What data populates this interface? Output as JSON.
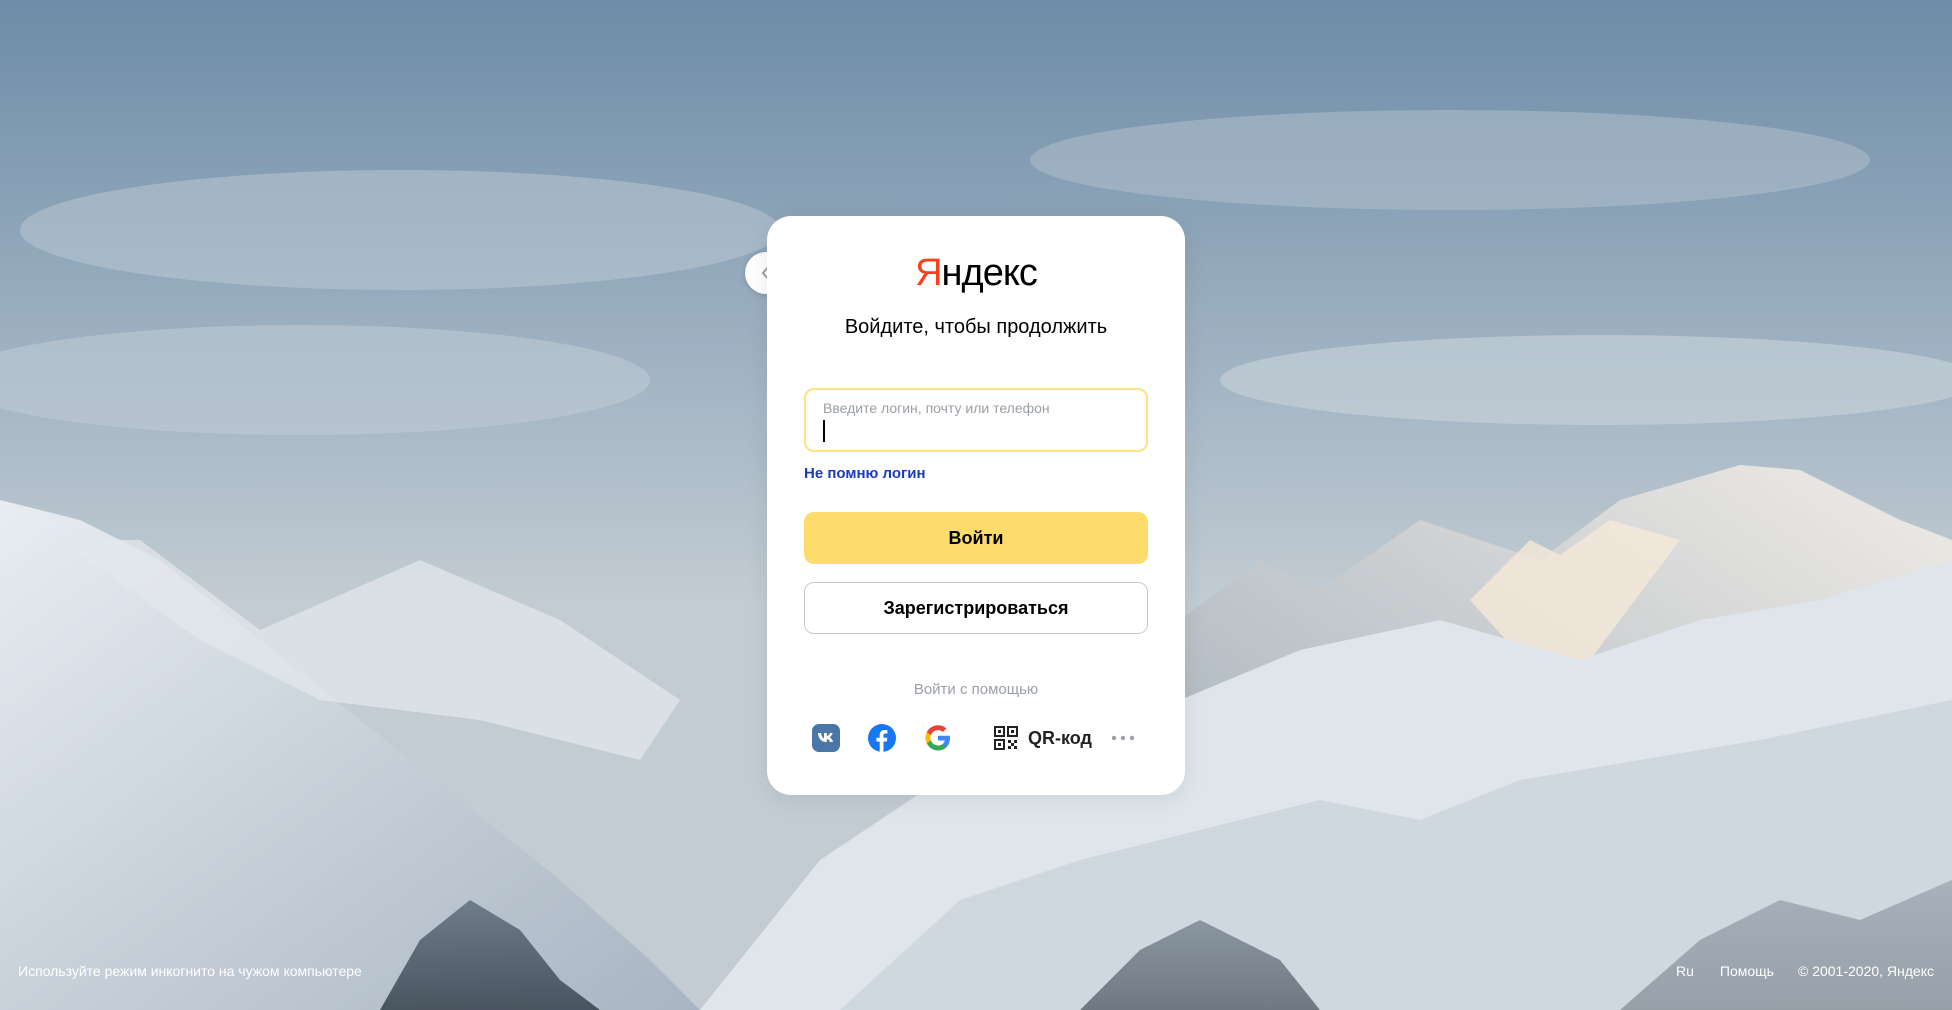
{
  "logo": {
    "ya": "Я",
    "rest": "ндекс"
  },
  "title": "Войдите, чтобы продолжить",
  "login": {
    "placeholder": "Введите логин, почту или телефон",
    "value": ""
  },
  "forgot_link": "Не помню логин",
  "buttons": {
    "login": "Войти",
    "register": "Зарегистрироваться"
  },
  "alt_login": {
    "title": "Войти с помощью",
    "providers": [
      "vk-icon",
      "facebook-icon",
      "google-icon"
    ],
    "qr_label": "QR-код",
    "more_icon": "ellipsis-icon"
  },
  "footer": {
    "incognito_tip": "Используйте режим инкогнито на чужом компьютере",
    "lang": "Ru",
    "help": "Помощь",
    "copyright": "© 2001-2020, Яндекс"
  },
  "colors": {
    "accent": "#fddc6b",
    "field_border": "#fce281",
    "link": "#1a3bbd",
    "logo_red": "#fc3f1d"
  }
}
